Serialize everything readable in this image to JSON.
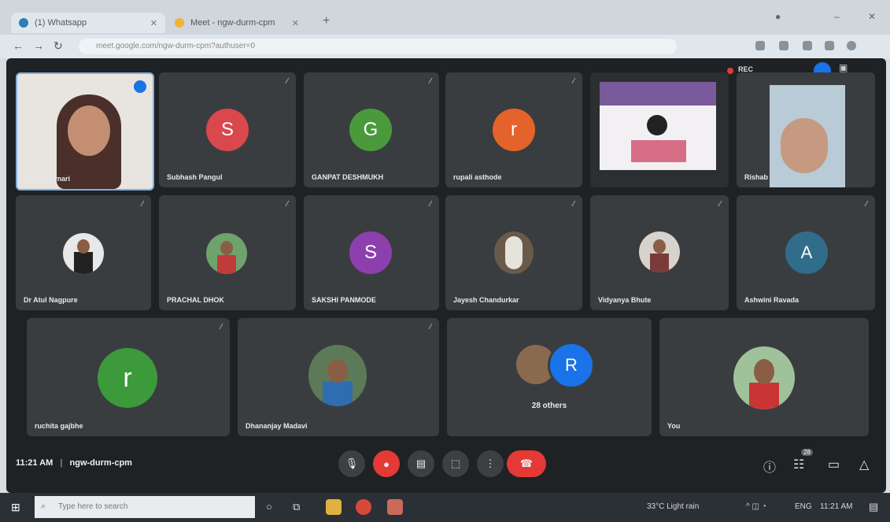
{
  "browser": {
    "tabs": [
      {
        "label": "(1) Whatsapp",
        "active": true
      },
      {
        "label": "Meet - ngw-durm-cpm",
        "active": false
      }
    ],
    "new_tab": "+",
    "address": "meet.google.com/ngw-durm-cpm?authuser=0"
  },
  "meeting": {
    "recording_label": "REC",
    "code": "ngw-durm-cpm",
    "time": "11:21 AM",
    "separator": "|",
    "participants": [
      {
        "name": "Swati Kumari",
        "kind": "video"
      },
      {
        "name": "Subhash Pangul",
        "kind": "letter",
        "letter": "S",
        "color": "#d9484d"
      },
      {
        "name": "GANPAT DESHMUKH",
        "kind": "letter",
        "letter": "G",
        "color": "#4a9a3c"
      },
      {
        "name": "rupali asthode",
        "kind": "letter",
        "letter": "r",
        "color": "#e4632a"
      },
      {
        "name": "",
        "kind": "screen"
      },
      {
        "name": "Rishab",
        "kind": "video"
      },
      {
        "name": "Dr Atul Nagpure",
        "kind": "photo"
      },
      {
        "name": "PRACHAL DHOK",
        "kind": "photo"
      },
      {
        "name": "SAKSHI PANMODE",
        "kind": "letter",
        "letter": "S",
        "color": "#8e3fae"
      },
      {
        "name": "Jayesh Chandurkar",
        "kind": "photo"
      },
      {
        "name": "Vidyanya Bhute",
        "kind": "photo"
      },
      {
        "name": "Ashwini Ravada",
        "kind": "letter",
        "letter": "A",
        "color": "#2f6d8a"
      },
      {
        "name": "ruchita gajbhe",
        "kind": "letter",
        "letter": "r",
        "color": "#3c9a3a"
      },
      {
        "name": "Dhananjay Madavi",
        "kind": "photo"
      },
      {
        "name": "28 others",
        "kind": "others",
        "letter": "R",
        "color": "#1a73e8"
      },
      {
        "name": "You",
        "kind": "photo"
      }
    ],
    "participant_count": "28"
  },
  "taskbar": {
    "search_placeholder": "Type here to search",
    "weather": "33°C Light rain",
    "lang": "ENG",
    "time": "11:21 AM"
  }
}
